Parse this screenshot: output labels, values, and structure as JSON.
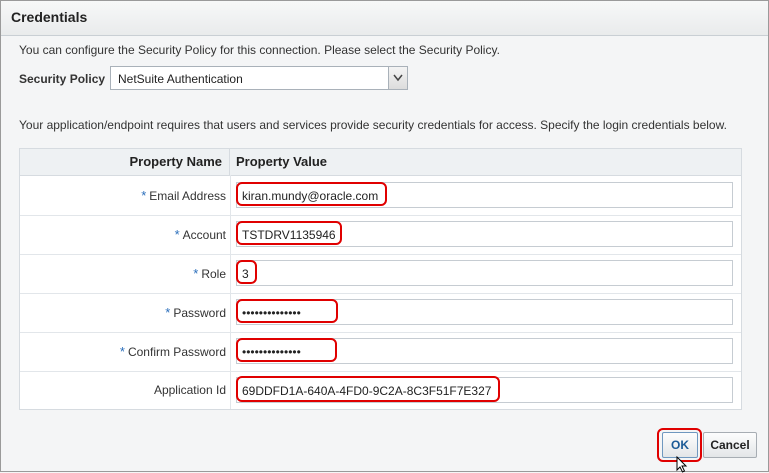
{
  "dialog": {
    "title": "Credentials",
    "intro_text": "You can configure the Security Policy for this connection. Please select the Security Policy.",
    "security_policy": {
      "label": "Security Policy",
      "selected": "NetSuite Authentication"
    },
    "note_text": "Your application/endpoint requires that users and services provide security credentials for access. Specify the login credentials below."
  },
  "table": {
    "headers": {
      "name": "Property Name",
      "value": "Property Value"
    },
    "required_marker": "*",
    "rows": [
      {
        "label": "Email Address",
        "value": "kiran.mundy@oracle.com",
        "required": true
      },
      {
        "label": "Account",
        "value": "TSTDRV1135946",
        "required": true
      },
      {
        "label": "Role",
        "value": "3",
        "required": true
      },
      {
        "label": "Password",
        "value": "••••••••••••••",
        "required": true
      },
      {
        "label": "Confirm Password",
        "value": "••••••••••••••",
        "required": true
      },
      {
        "label": "Application Id",
        "value": "69DDFD1A-640A-4FD0-9C2A-8C3F51F7E327",
        "required": false
      }
    ]
  },
  "buttons": {
    "ok": "OK",
    "cancel": "Cancel"
  },
  "colors": {
    "highlight": "#e00000",
    "required_star": "#2a6ebb",
    "ok_text": "#1a5a96"
  },
  "icons": {
    "dropdown": "chevron-down-icon",
    "cursor": "mouse-pointer-icon"
  }
}
